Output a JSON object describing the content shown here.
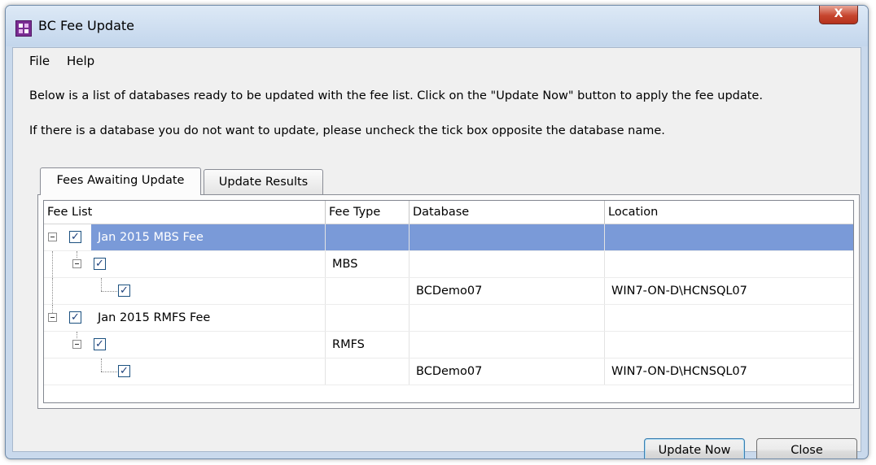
{
  "window": {
    "title": "BC Fee Update",
    "close_glyph": "X"
  },
  "menu": {
    "items": [
      "File",
      "Help"
    ]
  },
  "info": {
    "line1": "Below is a list of databases ready to be updated with the fee list.  Click on the \"Update Now\" button to apply the fee update.",
    "line2": "If there is a database you do not want to update, please uncheck the tick box opposite the database name."
  },
  "tabs": [
    {
      "label": "Fees Awaiting Update",
      "active": true
    },
    {
      "label": "Update Results",
      "active": false
    }
  ],
  "table": {
    "columns": [
      "Fee List",
      "Fee Type",
      "Database",
      "Location"
    ],
    "rows": [
      {
        "fee_list": "Jan 2015 MBS Fee",
        "fee_type": "",
        "database": "",
        "location": "",
        "checked": true,
        "level": 0,
        "selected": true
      },
      {
        "fee_list": "",
        "fee_type": "MBS",
        "database": "",
        "location": "",
        "checked": true,
        "level": 1,
        "selected": false
      },
      {
        "fee_list": "",
        "fee_type": "",
        "database": "BCDemo07",
        "location": "WIN7-ON-D\\HCNSQL07",
        "checked": true,
        "level": 2,
        "selected": false
      },
      {
        "fee_list": "Jan 2015 RMFS Fee",
        "fee_type": "",
        "database": "",
        "location": "",
        "checked": true,
        "level": 0,
        "selected": false
      },
      {
        "fee_list": "",
        "fee_type": "RMFS",
        "database": "",
        "location": "",
        "checked": true,
        "level": 1,
        "selected": false
      },
      {
        "fee_list": "",
        "fee_type": "",
        "database": "BCDemo07",
        "location": "WIN7-ON-D\\HCNSQL07",
        "checked": true,
        "level": 2,
        "selected": false
      }
    ]
  },
  "buttons": {
    "update_now": "Update Now",
    "close": "Close"
  },
  "colors": {
    "selection": "#7a9ad8",
    "close_button": "#c7462f",
    "app_icon": "#7a2c92"
  }
}
